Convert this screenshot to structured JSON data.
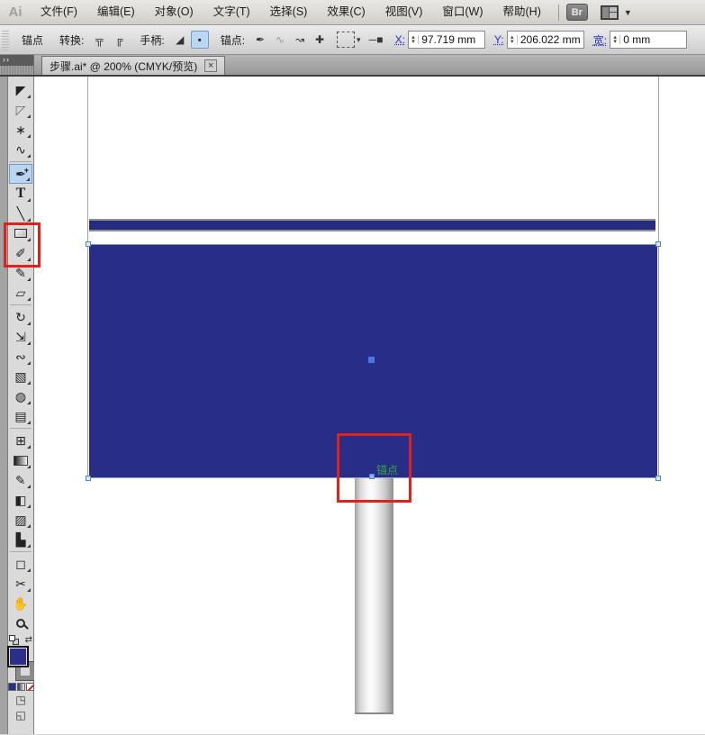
{
  "menu_bar": {
    "logo": "Ai",
    "items": [
      {
        "label": "文件(F)"
      },
      {
        "label": "编辑(E)"
      },
      {
        "label": "对象(O)"
      },
      {
        "label": "文字(T)"
      },
      {
        "label": "选择(S)"
      },
      {
        "label": "效果(C)"
      },
      {
        "label": "视图(V)"
      },
      {
        "label": "窗口(W)"
      },
      {
        "label": "帮助(H)"
      }
    ],
    "bridge_label": "Br",
    "workspace_caret": "▼"
  },
  "control_bar": {
    "tool_context_label": "锚点",
    "convert_label": "转换:",
    "convert_corner_glyph": "╦",
    "convert_smooth_glyph": "╔",
    "handles_label": "手柄:",
    "handles_show_glyph": "◢",
    "handles_hide_glyph": "▪",
    "anchors_label": "锚点:",
    "anchor_remove_glyph": "✒",
    "anchor_connect_glyph": "∿",
    "anchor_curve_glyph": "↝",
    "anchor_isolate_glyph": "✚",
    "select_menu_caret": "▾",
    "line_endpoint_glyph": "─■",
    "x_label": "X:",
    "x_value": "97.719 mm",
    "y_label": "Y:",
    "y_value": "206.022 mm",
    "width_label": "宽:",
    "width_value": "0 mm",
    "spinner_up": "▴",
    "spinner_down": "▾"
  },
  "tab_bar": {
    "panel_collapse_glyph": "››",
    "document_tab": {
      "title": "步骤.ai* @ 200% (CMYK/预览)",
      "close_glyph": "×"
    }
  },
  "toolbar": {
    "tools": [
      {
        "name": "selection-tool",
        "glyph": "◤"
      },
      {
        "name": "direct-selection-tool",
        "glyph": "◸"
      },
      {
        "name": "magic-wand-tool",
        "glyph": "∗"
      },
      {
        "name": "lasso-tool",
        "glyph": "∿"
      },
      {
        "name": "pen-tool",
        "glyph": "✒",
        "badge": "+",
        "selected": true
      },
      {
        "name": "type-tool",
        "glyph": "T"
      },
      {
        "name": "line-segment-tool",
        "glyph": "╲"
      },
      {
        "name": "rectangle-tool",
        "glyph": ""
      },
      {
        "name": "paintbrush-tool",
        "glyph": "✐"
      },
      {
        "name": "pencil-tool",
        "glyph": "✎"
      },
      {
        "name": "eraser-tool",
        "glyph": "▱"
      },
      {
        "name": "rotate-tool",
        "glyph": "↻"
      },
      {
        "name": "scale-tool",
        "glyph": "⇲"
      },
      {
        "name": "width-tool",
        "glyph": "∾"
      },
      {
        "name": "free-transform-tool",
        "glyph": "▧"
      },
      {
        "name": "shape-builder-tool",
        "glyph": "◍"
      },
      {
        "name": "perspective-grid-tool",
        "glyph": "▤"
      },
      {
        "name": "mesh-tool",
        "glyph": "⊞"
      },
      {
        "name": "gradient-tool",
        "glyph": ""
      },
      {
        "name": "eyedropper-tool",
        "glyph": "✏"
      },
      {
        "name": "blend-tool",
        "glyph": "◧"
      },
      {
        "name": "symbol-sprayer-tool",
        "glyph": "▨"
      },
      {
        "name": "column-graph-tool",
        "glyph": "▙"
      },
      {
        "name": "artboard-tool",
        "glyph": "◻"
      },
      {
        "name": "slice-tool",
        "glyph": "✂"
      },
      {
        "name": "hand-tool",
        "glyph": "✋"
      },
      {
        "name": "zoom-tool",
        "glyph": ""
      }
    ],
    "swap_glyph": "⇄",
    "draw_mode_glyph": "◳",
    "screen_mode_glyph": "◱",
    "fill_color": "#2a2f8b"
  },
  "canvas": {
    "anchor_label": "锚点",
    "sign_color": "#282d88",
    "strip_color": "#252b7e",
    "pole_colors": [
      "#a2a2a2",
      "#fdfdfd",
      "#8f8f8f"
    ],
    "annotation_color": "#de231b",
    "anchor_label_color": "#2fa63f",
    "selection_handle_color": "#4f86c8",
    "zoom_percent": "200%"
  }
}
